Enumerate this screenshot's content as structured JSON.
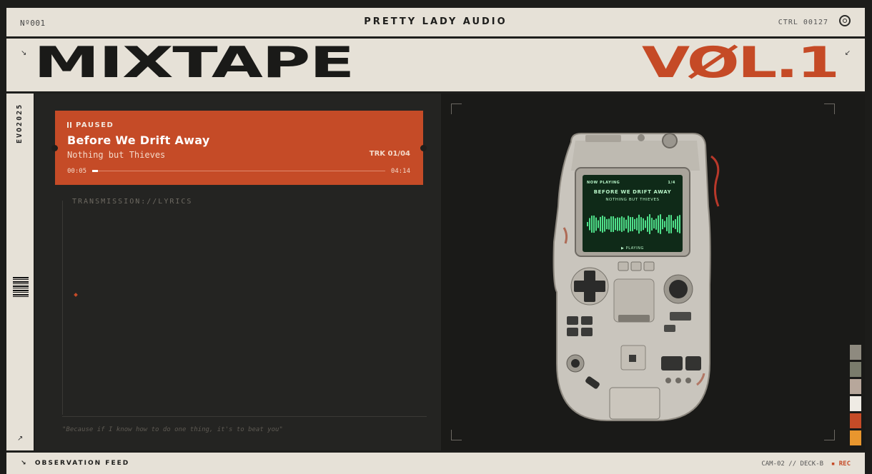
{
  "header": {
    "serial": "Nº001",
    "brand": "PRETTY LADY AUDIO",
    "ctrl": "CTRL 00127"
  },
  "title": {
    "main": "MIXTAPE",
    "volume": "VØL.1",
    "corner_left": "↘",
    "corner_right": "↙"
  },
  "sidebar": {
    "label": "EVO2025",
    "arrow": "↗"
  },
  "player": {
    "status": "PAUSED",
    "song": "Before We Drift Away",
    "artist": "Nothing but Thieves",
    "track": "TRK 01/04",
    "time_current": "00:05",
    "time_total": "04:14",
    "progress": 0.02
  },
  "lyrics": {
    "heading": "TRANSMISSION://LYRICS",
    "quote": "\"Because if I know how to do one thing, it's to beat you\""
  },
  "device_screen": {
    "top_label": "NOW PLAYING",
    "top_right": "1/4",
    "song": "BEFORE WE DRIFT AWAY",
    "artist": "NOTHING BUT THIEVES",
    "footer": "▶ PLAYING"
  },
  "swatches": [
    "#8e8a7f",
    "#7a7c6c",
    "#b7a79b",
    "#efebe4",
    "#c54b27",
    "#e8962e"
  ],
  "footer": {
    "feed": "OBSERVATION FEED",
    "cam": "CAM-02 // DECK-B",
    "rec": "REC"
  }
}
